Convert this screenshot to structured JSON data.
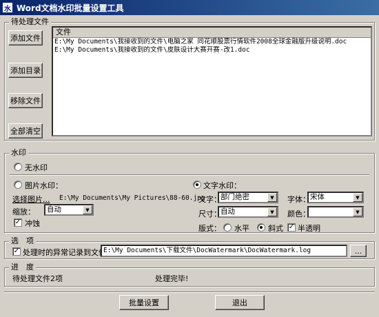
{
  "window": {
    "title": "Word文档水印批量设置工具",
    "icon_char": "水"
  },
  "pending": {
    "group_label": "待处理文件",
    "buttons": {
      "add_file": "添加文件",
      "add_dir": "添加目录",
      "remove_file": "移除文件",
      "clear_all": "全部清空"
    },
    "list_header": "文件",
    "files": [
      "E:\\My Documents\\我接收到的文件\\电脑之家 同花顺股票行情软件2008全球金融版升级说明.doc",
      "E:\\My Documents\\我接收到的文件\\皮肤设计大赛开赛-改1.doc"
    ]
  },
  "watermark": {
    "group_label": "水印",
    "none_label": "无水印",
    "image_label": "图片水印：",
    "choose_image_label": "选择图片...",
    "image_path": "E:\\My Documents\\My Pictures\\88-60.jpg",
    "scale_label": "缩放：",
    "scale_value": "自动",
    "washout_label": "冲蚀",
    "text_label": "文字水印：",
    "text_field_label": "文字：",
    "text_value": "部门绝密",
    "font_label": "字体：",
    "font_value": "宋体",
    "size_label": "尺寸：",
    "size_value": "自动",
    "color_label": "颜色：",
    "color_value": "",
    "layout_label": "版式：",
    "horizontal_label": "水平",
    "diagonal_label": "斜式",
    "semitransparent_label": "半透明"
  },
  "options": {
    "group_label": "选　项",
    "log_label": "处理时的异常记录到文件：",
    "log_path": "E:\\My Documents\\下载文件\\DocWatermark\\DocWatermark.log",
    "browse_label": "..."
  },
  "progress": {
    "group_label": "进　度",
    "pending_count_text": "待处理文件2项",
    "status_text": "处理完毕!"
  },
  "actions": {
    "batch_label": "批量设置",
    "exit_label": "退出"
  },
  "state": {
    "watermark_mode": "text",
    "washout_checked": true,
    "layout": "diagonal",
    "semitransparent_checked": true,
    "log_checked": true
  }
}
